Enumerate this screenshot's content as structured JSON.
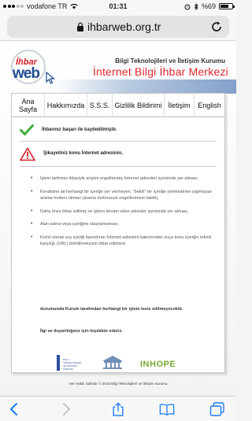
{
  "status_bar": {
    "carrier": "vodafone TR",
    "time": "01:31",
    "battery_percent": "%69",
    "battery_level": 0.69
  },
  "url_bar": {
    "url": "ihbarweb.org.tr"
  },
  "header": {
    "logo_text_ihbar": "İhbar",
    "logo_text_web": "web",
    "subtitle": "Bilgi Teknolojileri ve İletişim Kurumu",
    "title": "İnternet Bilgi İhbar Merkezi"
  },
  "nav": {
    "items": [
      {
        "label": "Ana Sayfa"
      },
      {
        "label": "Hakkımızda"
      },
      {
        "label": "S.S.S."
      },
      {
        "label": "Gizlilik Bildirimi"
      },
      {
        "label": "İletişim"
      },
      {
        "label": "English"
      }
    ]
  },
  "messages": {
    "success": "İhbarınız başarı ile kaydedilmiştir.",
    "warning": "Şikayetiniz konu İnternet adresinin,"
  },
  "list_items": [
    "İşlem tarihimiz itibariyle erişimi engellenmiş İnternet adresleri içerisinde yer alması,",
    "Kendisine ait herhangi bir içeriğe yer vermeyen, \"belirli\" bir içeriğe yönlendirme yapmayan arama motoru olması (arama motorunun engellenmesi talebi),",
    "Daha önce ihbar edilmiş ve işlemi devam eden adresler içerisinde yer alması,",
    "Alan adına veya içeriğine ulaşılamaması,",
    "Kısmi olarak suç içeriği barındıran İnternet adresleri bakımından suça konu içeriğin teknik karşılığı (URL) belirtilmeksizin ihbar edilmesi"
  ],
  "closing": {
    "line1": "durumunda Kurum tarafından herhangi bir işlem tesis edilmeyecektir.",
    "line2": "İlgi ve duyarlılığınız için teşekkür ederiz."
  },
  "footer": {
    "logo1_text": "BİLGİ TEKNOLOJİLERİ VE İLETİŞİM KURUMU",
    "logo3_text": "INHOPE",
    "copyright": "Her Hakkı Saklıdır © 2018 Bilgi Teknolojileri ve İletişim Kurumu"
  },
  "colors": {
    "accent_red": "#e2262d",
    "brand_blue": "#1f4b8f",
    "success_green": "#3fae3f",
    "warning_red": "#d61f26",
    "ios_blue": "#1a7cf5"
  }
}
